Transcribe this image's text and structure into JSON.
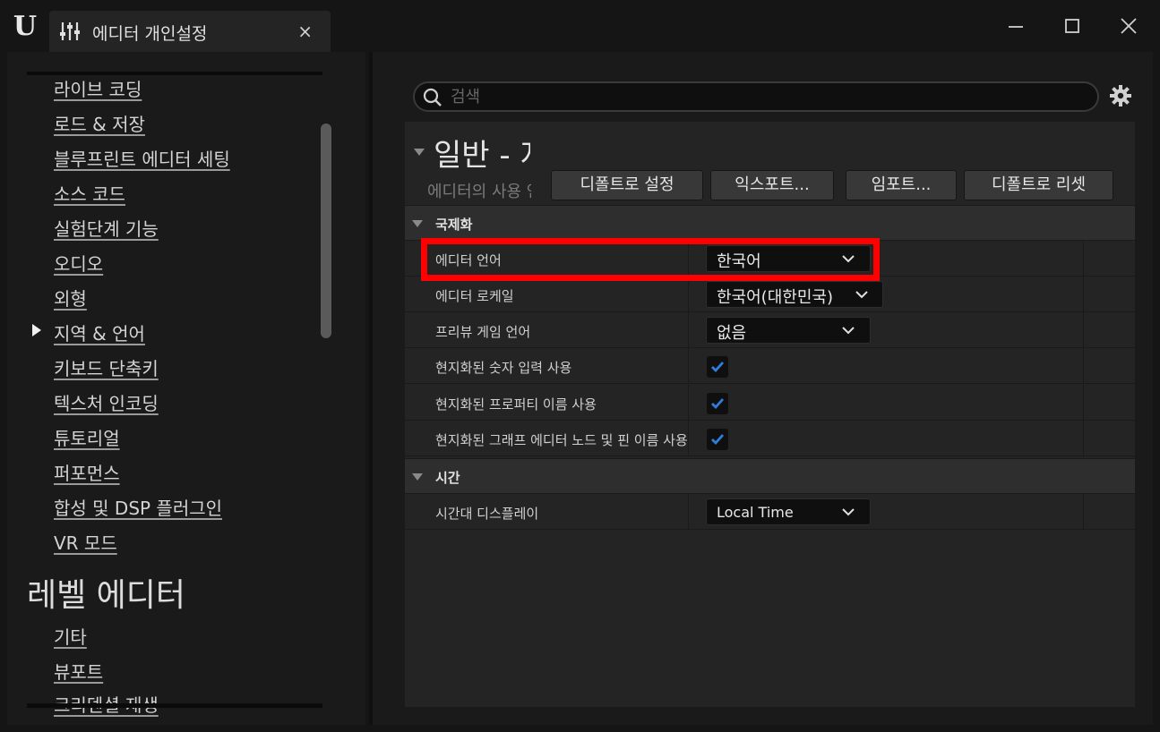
{
  "window": {
    "tab_title": "에디터 개인설정",
    "tab_close": "×"
  },
  "sidebar": {
    "items": [
      {
        "label": "라이브 코딩"
      },
      {
        "label": "로드 & 저장"
      },
      {
        "label": "블루프린트 에디터 세팅"
      },
      {
        "label": "소스 코드"
      },
      {
        "label": "실험단계 기능"
      },
      {
        "label": "오디오"
      },
      {
        "label": "외형"
      },
      {
        "label": "지역 & 언어",
        "selected": true
      },
      {
        "label": "키보드 단축키"
      },
      {
        "label": "텍스처 인코딩"
      },
      {
        "label": "튜토리얼"
      },
      {
        "label": "퍼포먼스"
      },
      {
        "label": "합성 및 DSP 플러그인"
      },
      {
        "label": "VR 모드"
      }
    ],
    "section2_title": "레벨 에디터",
    "section2_items": [
      {
        "label": "기타"
      },
      {
        "label": "뷰포트"
      },
      {
        "label": "크리덴셜 재생"
      }
    ]
  },
  "search": {
    "placeholder": "검색"
  },
  "category": {
    "title": "일반 - 지역 & 언어",
    "description": "에디터의 사용 언어",
    "buttons": {
      "set_default": "디폴트로 설정",
      "export": "익스포트...",
      "import": "임포트...",
      "reset_default": "디폴트로 리셋"
    }
  },
  "sections": {
    "internationalization": {
      "label": "국제화",
      "rows": {
        "editor_language": {
          "label": "에디터 언어",
          "value": "한국어"
        },
        "editor_locale": {
          "label": "에디터 로케일",
          "value": "한국어(대한민국)"
        },
        "preview_game_language": {
          "label": "프리뷰 게임 언어",
          "value": "없음"
        },
        "localized_numeric_input": {
          "label": "현지화된 숫자 입력 사용",
          "checked": true
        },
        "localized_property_names": {
          "label": "현지화된 프로퍼티 이름 사용",
          "checked": true
        },
        "localized_graph_names": {
          "label": "현지화된 그래프 에디터 노드 및 핀 이름 사용",
          "checked": true
        }
      }
    },
    "time": {
      "label": "시간",
      "rows": {
        "timezone_display": {
          "label": "시간대 디스플레이",
          "value": "Local Time"
        }
      }
    }
  },
  "colors": {
    "highlight": "#ff0000",
    "checkmark": "#2f7fdc"
  }
}
